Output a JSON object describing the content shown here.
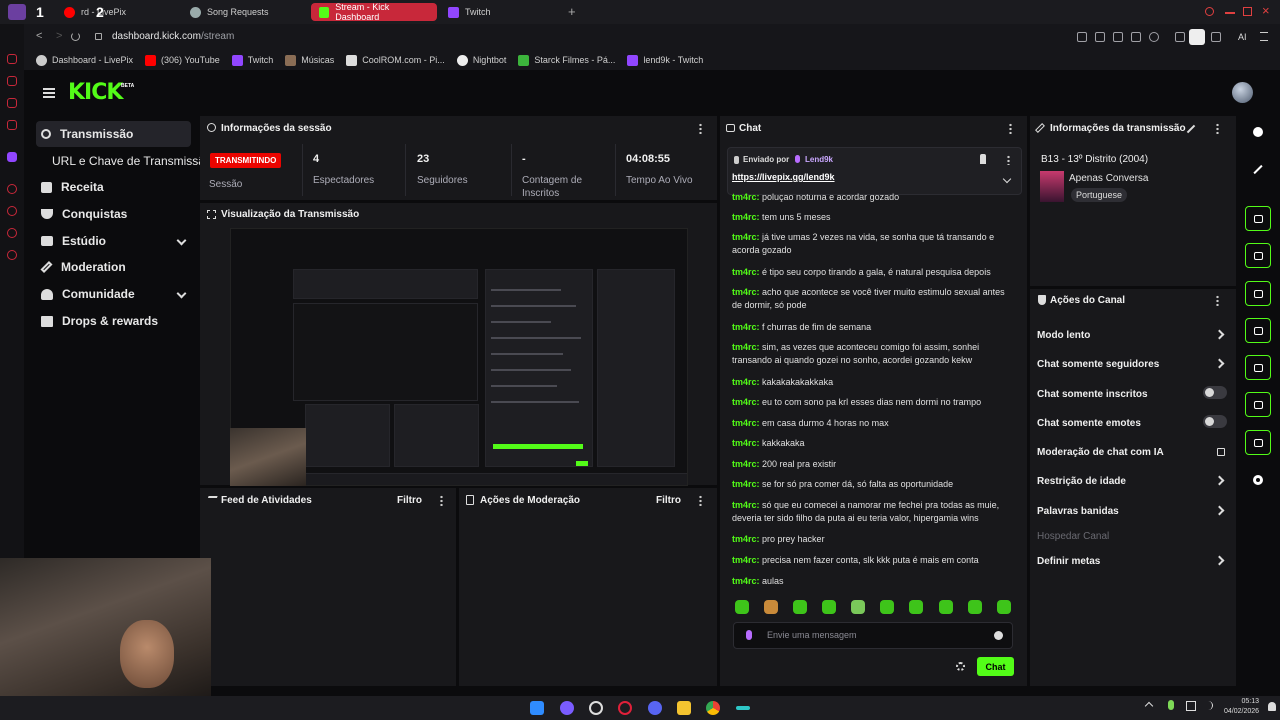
{
  "browser": {
    "tabs": [
      {
        "label": "rd - LivePix",
        "active": false
      },
      {
        "label": "Song Requests",
        "active": false
      },
      {
        "label": "Stream - Kick Dashboard",
        "active": true
      },
      {
        "label": "Twitch",
        "active": false
      }
    ],
    "tab_numbers": [
      "1",
      "2"
    ],
    "url_host": "dashboard.kick.com",
    "url_path": "/stream",
    "ai_label": "AI",
    "bookmarks": [
      "Dashboard - LivePix",
      "(306) YouTube",
      "Twitch",
      "Músicas",
      "CoolROM.com - Pi...",
      "Nightbot",
      "Starck Filmes - Pá...",
      "lend9k - Twitch"
    ]
  },
  "kick": {
    "logo": "KICK",
    "beta": "BETA",
    "sidebar": [
      {
        "label": "Transmissão",
        "active": true,
        "icon": "broadcast-icon"
      },
      {
        "label": "URL e Chave de Transmissão",
        "sub": true
      },
      {
        "label": "Receita",
        "icon": "chart-icon"
      },
      {
        "label": "Conquistas",
        "icon": "trophy-icon"
      },
      {
        "label": "Estúdio",
        "icon": "studio-icon",
        "expandable": true
      },
      {
        "label": "Moderation",
        "icon": "wrench-icon"
      },
      {
        "label": "Comunidade",
        "icon": "people-icon",
        "expandable": true
      },
      {
        "label": "Drops & rewards",
        "icon": "gift-icon"
      }
    ],
    "session": {
      "title": "Informações da sessão",
      "status_badge": "TRANSMITINDO",
      "status_label": "Sessão",
      "stats": [
        {
          "value": "4",
          "label": "Espectadores"
        },
        {
          "value": "23",
          "label": "Seguidores"
        },
        {
          "value": "-",
          "label": "Contagem de Inscritos"
        },
        {
          "value": "04:08:55",
          "label": "Tempo Ao Vivo"
        }
      ]
    },
    "preview_title": "Visualização da Transmissão",
    "activity_feed": {
      "title": "Feed de Atividades",
      "filter": "Filtro"
    },
    "mod_actions": {
      "title": "Ações de Moderação",
      "filter": "Filtro"
    },
    "chat": {
      "title": "Chat",
      "pinned_by": "Enviado por",
      "pinned_user": "Lend9k",
      "pinned_link": "https://livepix.gg/lend9k",
      "messages": [
        {
          "user": "tm4rc:",
          "text": "poluçao noturna e acordar gozado"
        },
        {
          "user": "tm4rc:",
          "text": "tem uns 5 meses"
        },
        {
          "user": "tm4rc:",
          "text": "já tive umas 2 vezes na vida, se sonha que tá transando e acorda gozado"
        },
        {
          "user": "tm4rc:",
          "text": "é tipo seu corpo tirando a gala, é natural pesquisa depois"
        },
        {
          "user": "tm4rc:",
          "text": "acho que acontece se você tiver muito estimulo sexual antes de dormir, só pode"
        },
        {
          "user": "tm4rc:",
          "text": "f churras de fim de semana"
        },
        {
          "user": "tm4rc:",
          "text": "sim, as vezes que aconteceu comigo foi assim, sonhei transando ai quando gozei no sonho, acordei gozando kekw"
        },
        {
          "user": "tm4rc:",
          "text": "kakakakakakkaka"
        },
        {
          "user": "tm4rc:",
          "text": "eu to com sono pa krl esses dias nem dormi no trampo"
        },
        {
          "user": "tm4rc:",
          "text": "em casa durmo 4 horas no max"
        },
        {
          "user": "tm4rc:",
          "text": "kakkakaka"
        },
        {
          "user": "tm4rc:",
          "text": "200 real pra existir"
        },
        {
          "user": "tm4rc:",
          "text": "se for só pra comer dá, só falta as oportunidade"
        },
        {
          "user": "tm4rc:",
          "text": "só que eu comecei a namorar me fechei pra todas as muie, deveria ter sido filho da puta ai eu teria valor, hipergamia wins"
        },
        {
          "user": "tm4rc:",
          "text": "pro prey hacker"
        },
        {
          "user": "tm4rc:",
          "text": "precisa nem fazer conta, slk kkk puta é mais em conta"
        },
        {
          "user": "tm4rc:",
          "text": "aulas"
        }
      ],
      "input_placeholder": "Envie uma mensagem",
      "send_label": "Chat"
    },
    "stream_info": {
      "title": "Informações da transmissão",
      "stream_title": "B13 - 13º Distrito (2004)",
      "category": "Apenas Conversa",
      "language": "Portuguese"
    },
    "channel_actions": {
      "title": "Ações do Canal",
      "items": [
        {
          "label": "Modo lento",
          "kind": "arrow"
        },
        {
          "label": "Chat somente seguidores",
          "kind": "arrow"
        },
        {
          "label": "Chat somente inscritos",
          "kind": "toggle",
          "on": false
        },
        {
          "label": "Chat somente emotes",
          "kind": "toggle",
          "on": false
        },
        {
          "label": "Moderação de chat com IA",
          "kind": "external"
        },
        {
          "label": "Restrição de idade",
          "kind": "arrow"
        },
        {
          "label": "Palavras banidas",
          "kind": "arrow"
        },
        {
          "label": "Hospedar Canal",
          "kind": "disabled"
        },
        {
          "label": "Definir metas",
          "kind": "arrow"
        }
      ]
    }
  },
  "taskbar": {
    "time": "05:13",
    "date": "04/02/2026"
  },
  "colors": {
    "kick_green": "#53fc18",
    "live_red": "#eb0400",
    "panel": "#18181b",
    "tab_active": "#c8283a"
  }
}
